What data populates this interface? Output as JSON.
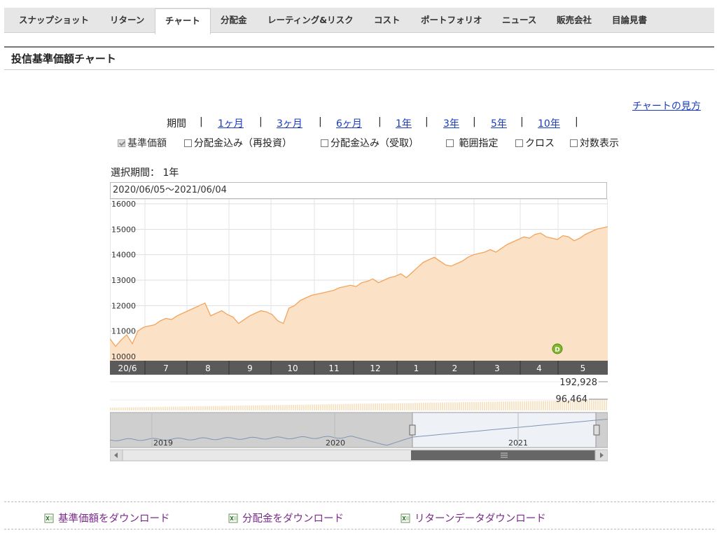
{
  "nav": {
    "tabs": [
      {
        "label": "スナップショット"
      },
      {
        "label": "リターン"
      },
      {
        "label": "チャート",
        "active": true
      },
      {
        "label": "分配金"
      },
      {
        "label": "レーティング&リスク"
      },
      {
        "label": "コスト"
      },
      {
        "label": "ポートフォリオ"
      },
      {
        "label": "ニュース"
      },
      {
        "label": "販売会社"
      },
      {
        "label": "目論見書"
      }
    ]
  },
  "section_title": "投信基準価額チャート",
  "howto_link": "チャートの見方",
  "period": {
    "label": "期間",
    "options": [
      "1ヶ月",
      "3ヶ月",
      "6ヶ月",
      "1年",
      "3年",
      "5年",
      "10年"
    ]
  },
  "options": [
    {
      "label": "基準価額",
      "checked": true,
      "disabled": true
    },
    {
      "label": "分配金込み（再投資）",
      "checked": false
    },
    {
      "label": "分配金込み（受取）",
      "checked": false
    },
    {
      "label": "範囲指定",
      "checked": false
    },
    {
      "label": "クロス",
      "checked": false
    },
    {
      "label": "対数表示",
      "checked": false
    }
  ],
  "selected_period": "選択期間： 1年",
  "date_range": "2020/06/05〜2021/06/04",
  "chart_data": {
    "type": "area",
    "ylim": [
      10000,
      16000
    ],
    "yticks": [
      "16000",
      "15000",
      "14000",
      "13000",
      "12000",
      "11000",
      "10000"
    ],
    "x_month_labels": [
      "20/6",
      "7",
      "8",
      "9",
      "10",
      "11",
      "12",
      "1",
      "2",
      "3",
      "4",
      "5"
    ],
    "values": [
      10700,
      10400,
      10650,
      10850,
      10500,
      11000,
      11150,
      11200,
      11250,
      11400,
      11500,
      11450,
      11600,
      11700,
      11800,
      11900,
      12000,
      12100,
      11600,
      11700,
      11800,
      11650,
      11550,
      11300,
      11450,
      11600,
      11700,
      11800,
      11750,
      11650,
      11400,
      11300,
      11900,
      12000,
      12200,
      12300,
      12400,
      12450,
      12500,
      12550,
      12600,
      12700,
      12750,
      12800,
      12750,
      12900,
      12950,
      13050,
      12900,
      13000,
      13100,
      13150,
      13250,
      13100,
      13300,
      13500,
      13700,
      13800,
      13900,
      13750,
      13600,
      13550,
      13650,
      13750,
      13900,
      14000,
      14050,
      14100,
      14200,
      14100,
      14250,
      14400,
      14500,
      14600,
      14700,
      14650,
      14800,
      14850,
      14700,
      14650,
      14600,
      14750,
      14700,
      14550,
      14650,
      14800,
      14900,
      15000,
      15050,
      15100
    ],
    "color": "#f3a35a",
    "fill": "#fbe2c6",
    "distribution_marker": "D",
    "volume_labels": [
      "192,928",
      "96,464"
    ],
    "navigator_years": [
      "2019",
      "2020",
      "2021"
    ]
  },
  "downloads": [
    {
      "label": "基準価額をダウンロード"
    },
    {
      "label": "分配金をダウンロード"
    },
    {
      "label": "リターンデータダウンロード"
    }
  ],
  "colors": {
    "link": "#1a3bc1",
    "download": "#7a2a8a"
  }
}
